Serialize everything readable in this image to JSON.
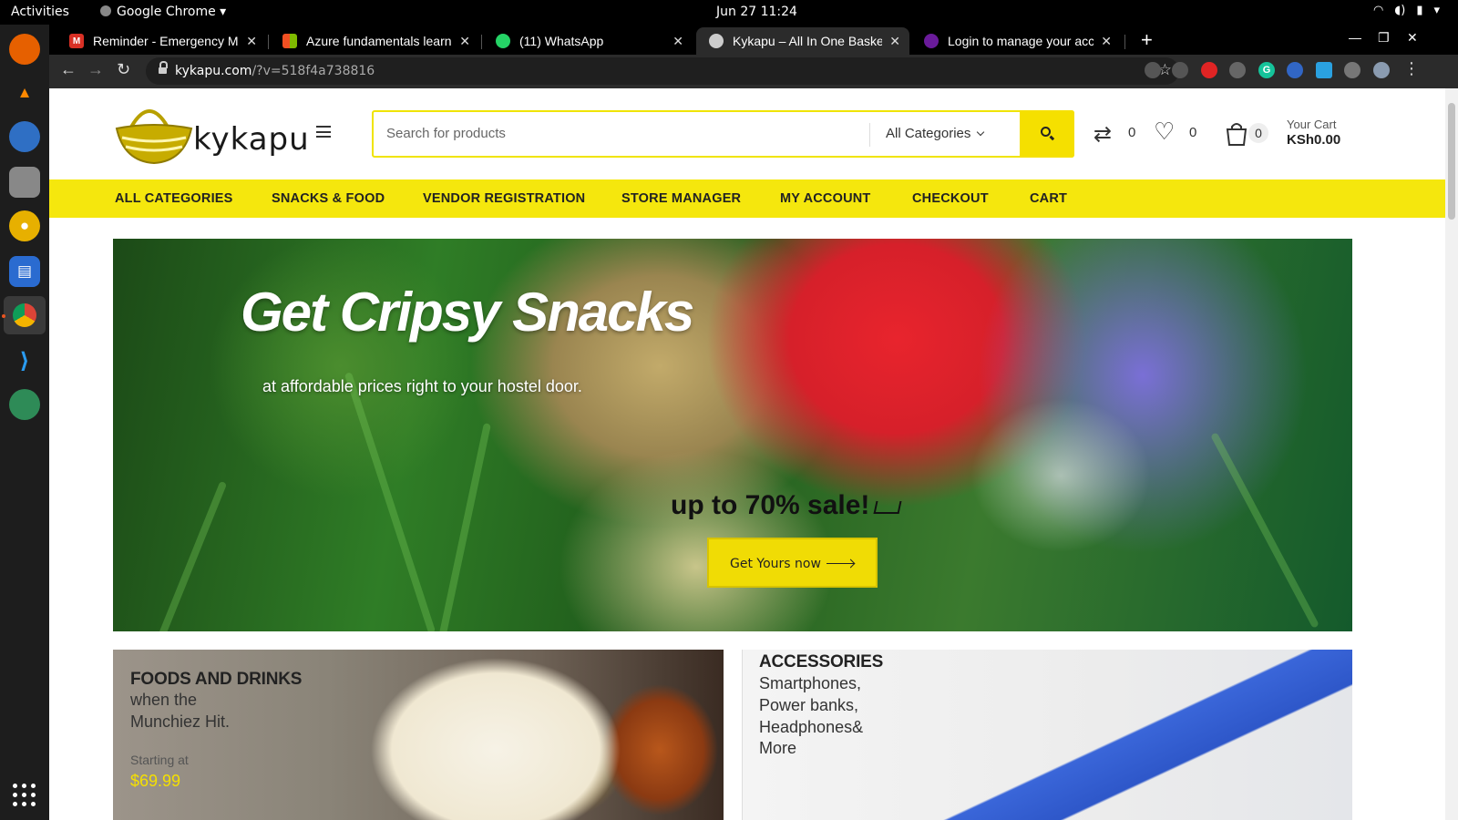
{
  "os": {
    "activities": "Activities",
    "app_name": "Google Chrome",
    "clock": "Jun 27  11:24"
  },
  "browser": {
    "tabs": [
      {
        "title": "Reminder - Emergency Ma",
        "favicon": "gmail-icon",
        "color": "#d93025"
      },
      {
        "title": "Azure fundamentals learn",
        "favicon": "microsoft-icon",
        "color": "#f25022"
      },
      {
        "title": "(11) WhatsApp",
        "favicon": "whatsapp-icon",
        "color": "#25d366"
      },
      {
        "title": "Kykapu – All In One Baske",
        "favicon": "globe-icon",
        "color": "#cccccc"
      },
      {
        "title": "Login to manage your acc",
        "favicon": "account-icon",
        "color": "#6a1b9a"
      }
    ],
    "url_host": "kykapu.com",
    "url_rest": "/?v=518f4a738816"
  },
  "site": {
    "logo_text": "kykapu",
    "search_placeholder": "Search for products",
    "category_select": "All Categories",
    "compare_count": "0",
    "wishlist_count": "0",
    "cart_count": "0",
    "cart_label": "Your Cart",
    "cart_total": "KSh0.00",
    "nav": [
      "ALL CATEGORIES",
      "SNACKS & FOOD",
      "VENDOR REGISTRATION",
      "STORE MANAGER",
      "MY ACCOUNT",
      "CHECKOUT",
      "CART"
    ],
    "accent": "#f5e70d"
  },
  "hero": {
    "title": "Get Cripsy Snacks",
    "subtitle": "at affordable prices right to your hostel door.",
    "sale": "up to 70% sale!",
    "cta": "Get Yours now"
  },
  "promos": {
    "food": {
      "heading": "FOODS AND DRINKS",
      "line1": "when the",
      "line2": "Munchiez Hit.",
      "starting": "Starting at",
      "price": "$69.99"
    },
    "accessories": {
      "heading": "ACCESSORIES",
      "line1": "Smartphones,",
      "line2": "Power banks,",
      "line3": "Headphones&",
      "line4": "More"
    }
  }
}
